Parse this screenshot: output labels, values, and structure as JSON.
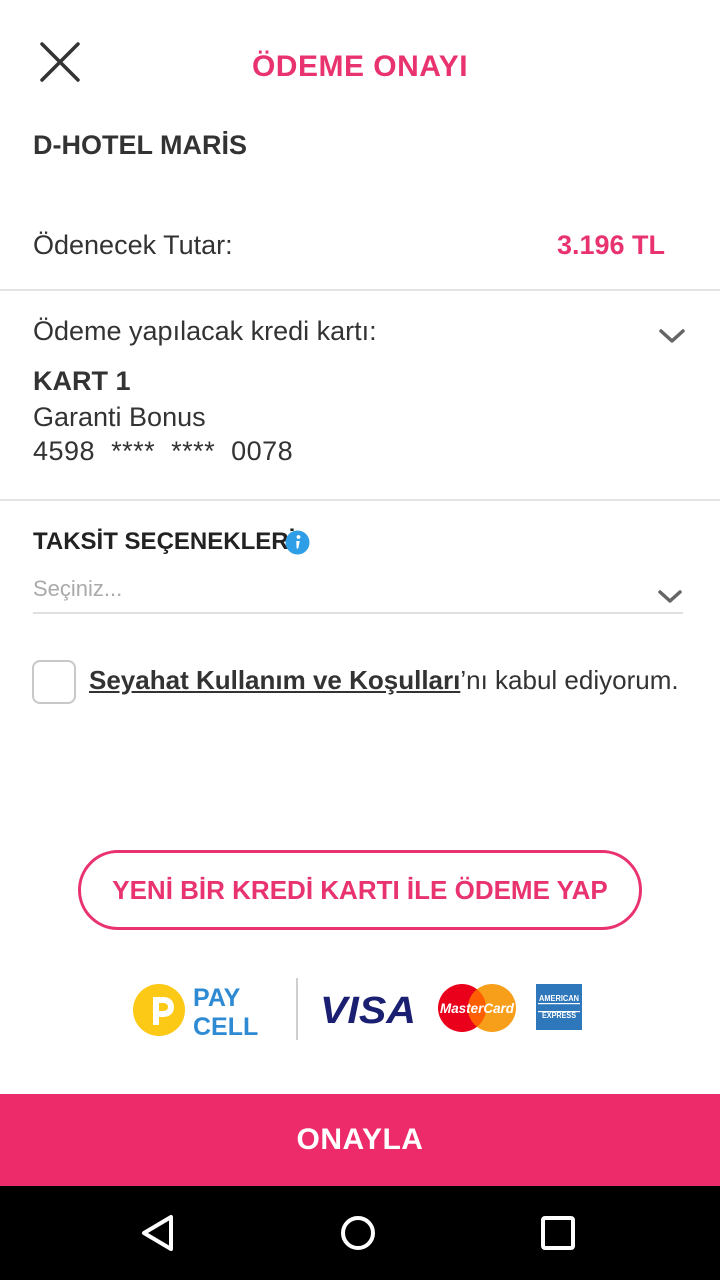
{
  "header": {
    "title": "ÖDEME ONAYI",
    "close_icon": "close-icon"
  },
  "hotel": {
    "name": "D-HOTEL MARİS"
  },
  "amount": {
    "label": "Ödenecek Tutar:",
    "value": "3.196 TL"
  },
  "card": {
    "label": "Ödeme yapılacak kredi kartı:",
    "name": "KART 1",
    "bank": "Garanti Bonus",
    "number": "4598  ****  ****  0078",
    "chevron_icon": "chevron-down-icon"
  },
  "installments": {
    "title": "TAKSİT SEÇENEKLERİ",
    "placeholder": "Seçiniz...",
    "info_icon": "info-icon"
  },
  "terms": {
    "link_text": "Seyahat Kullanım ve Koşulları",
    "suffix": "’nı kabul ediyorum.",
    "checked": false
  },
  "new_card_button": {
    "label": "YENİ BİR KREDİ KARTI İLE ÖDEME YAP"
  },
  "payment_logos": {
    "paycell_line1": "PAY",
    "paycell_line2": "CELL",
    "visa": "VISA",
    "mastercard": "MasterCard",
    "amex_line1": "AMERICAN",
    "amex_line2": "EXPRESS"
  },
  "confirm_button": {
    "label": "ONAYLA"
  },
  "colors": {
    "accent": "#e8336f",
    "confirm_bg": "#ed2b6a",
    "paycell_yellow": "#fcc916",
    "paycell_blue": "#2e8bd3",
    "visa_blue": "#1a1f71",
    "amex_blue": "#2e77bb"
  },
  "system_nav": {
    "back_icon": "back-triangle-icon",
    "home_icon": "home-circle-icon",
    "recents_icon": "recents-square-icon"
  }
}
